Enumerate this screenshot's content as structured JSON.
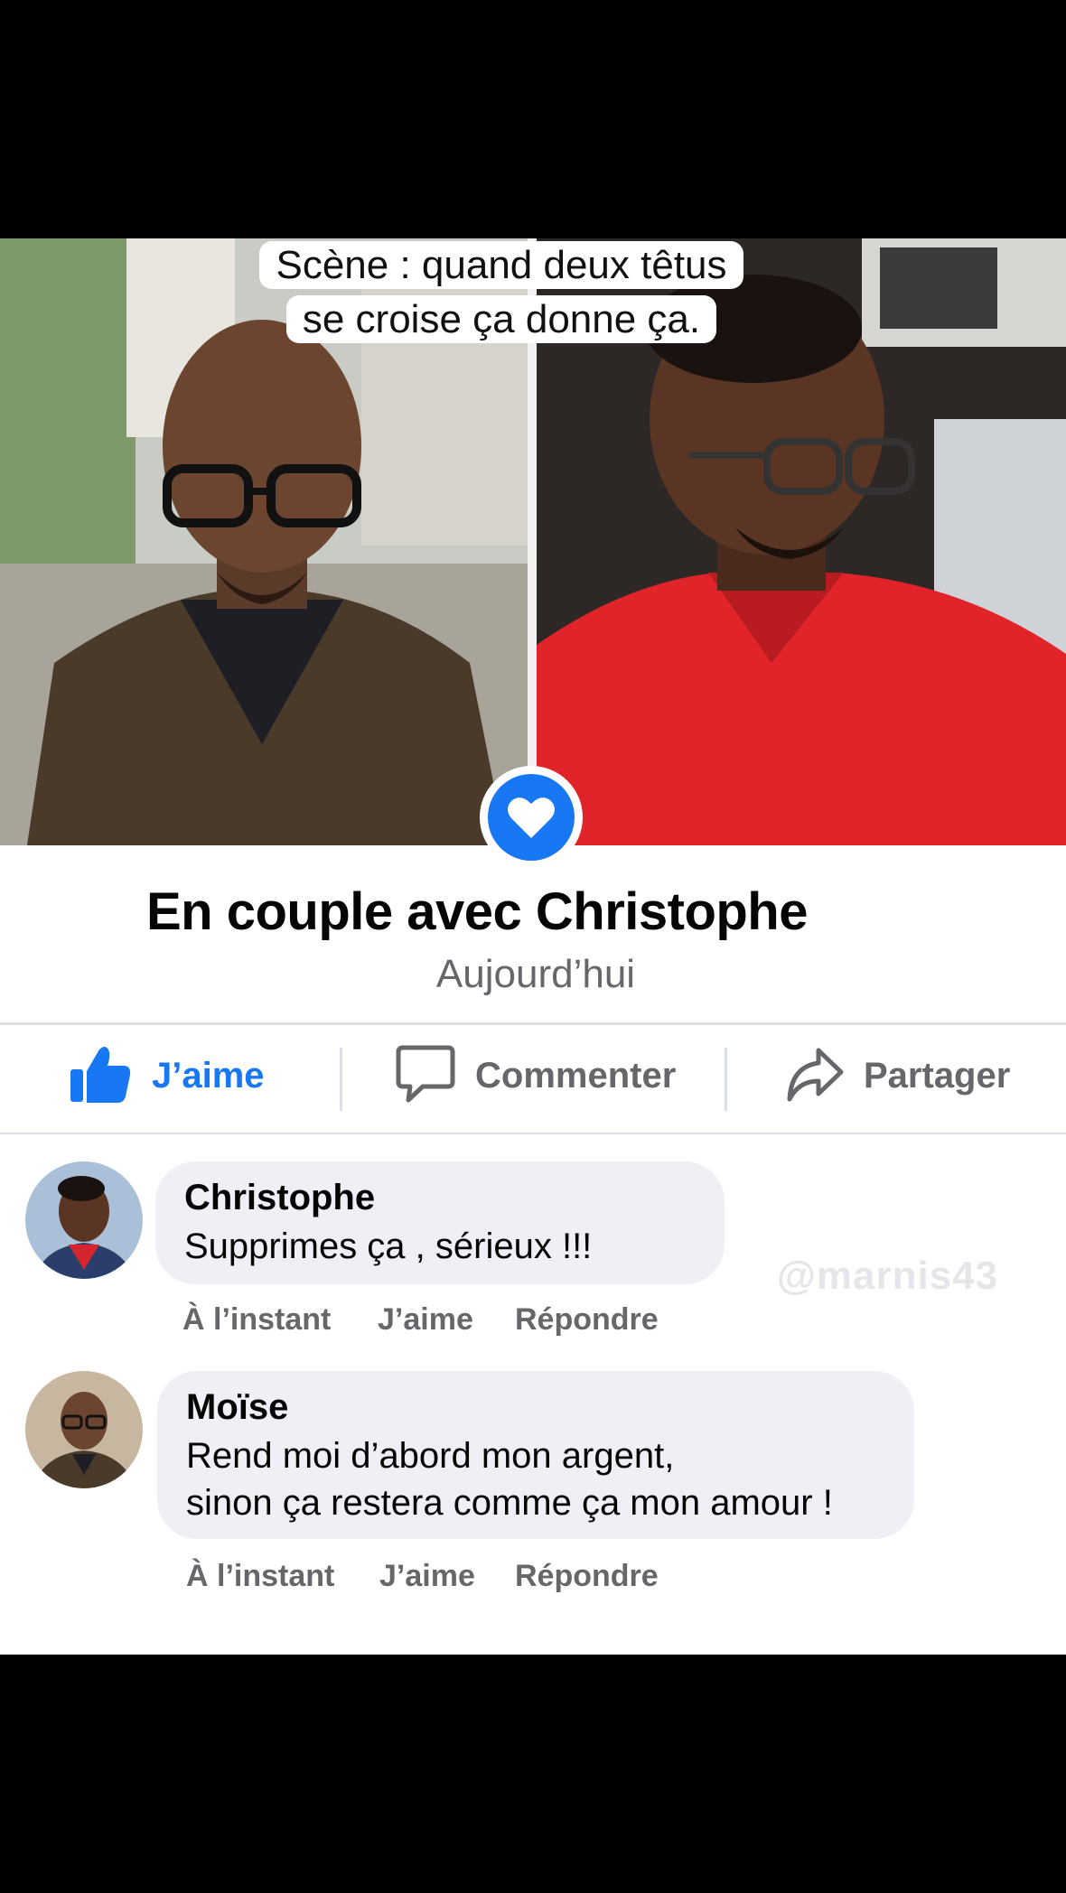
{
  "caption": {
    "line1": "Scène : quand deux têtus",
    "line2": "se croise ça donne ça."
  },
  "relationship": {
    "title": "En couple avec Christophe",
    "date": "Aujourd’hui",
    "badge_icon": "heart-icon",
    "accent_color": "#1877f2"
  },
  "actions": {
    "like": "J’aime",
    "comment": "Commenter",
    "share": "Partager"
  },
  "comments": [
    {
      "author": "Christophe",
      "text": "Supprimes ça , sérieux !!!",
      "time": "À l’instant",
      "like": "J’aime",
      "reply": "Répondre"
    },
    {
      "author": "Moïse",
      "text": "Rend moi d’abord mon argent,\nsinon ça restera comme ça mon amour !",
      "time": "À l’instant",
      "like": "J’aime",
      "reply": "Répondre"
    }
  ],
  "watermark": "@marnis43"
}
